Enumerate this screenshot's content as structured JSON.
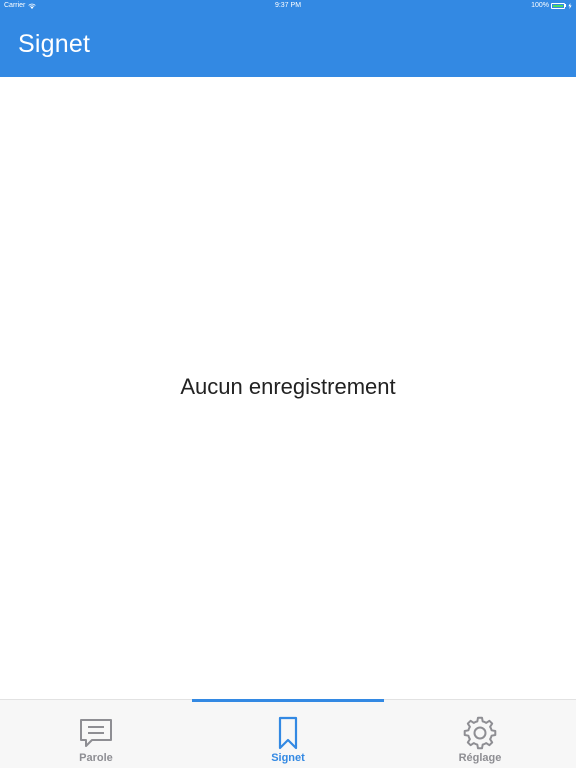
{
  "status_bar": {
    "carrier": "Carrier",
    "time": "9:37 PM",
    "battery": "100%"
  },
  "nav": {
    "title": "Signet"
  },
  "content": {
    "empty_message": "Aucun enregistrement"
  },
  "tabs": [
    {
      "label": "Parole",
      "icon": "message-icon",
      "active": false
    },
    {
      "label": "Signet",
      "icon": "bookmark-icon",
      "active": true
    },
    {
      "label": "Réglage",
      "icon": "gear-icon",
      "active": false
    }
  ],
  "colors": {
    "accent": "#3389e3",
    "inactive": "#8e8e93",
    "tab_bar_bg": "#f7f7f7",
    "battery_fill": "#4cd964"
  }
}
